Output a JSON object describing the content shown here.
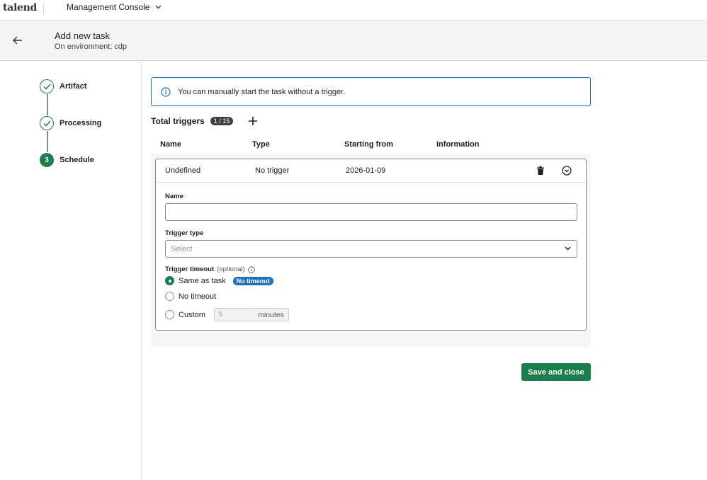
{
  "topbar": {
    "brand": "talend",
    "app_name": "Management Console"
  },
  "header": {
    "title": "Add new task",
    "subtitle": "On environment: cdp"
  },
  "stepper": {
    "steps": [
      {
        "label": "Artifact",
        "status": "done"
      },
      {
        "label": "Processing",
        "status": "done"
      },
      {
        "label": "Schedule",
        "status": "active",
        "number": "3"
      }
    ]
  },
  "info_banner": {
    "text": "You can manually start the task without a trigger."
  },
  "triggers": {
    "title": "Total triggers",
    "count": "1 / 15",
    "columns": [
      "Name",
      "Type",
      "Starting from",
      "Information"
    ],
    "rows": [
      {
        "name": "Undefined",
        "type": "No trigger",
        "starting_from": "2026-01-09",
        "information": ""
      }
    ]
  },
  "form": {
    "name_label": "Name",
    "name_value": "",
    "trigger_type_label": "Trigger type",
    "trigger_type_placeholder": "Select",
    "timeout_label": "Trigger timeout",
    "timeout_optional": "(optional)",
    "options": {
      "same_as_task": "Same as task",
      "same_as_task_tag": "No timeout",
      "no_timeout": "No timeout",
      "custom": "Custom"
    },
    "selected_option": "same_as_task",
    "custom_value": "5",
    "custom_unit": "minutes"
  },
  "actions": {
    "save_close": "Save and close"
  },
  "colors": {
    "primary": "#1a7f4b",
    "info": "#1f6fc5"
  }
}
